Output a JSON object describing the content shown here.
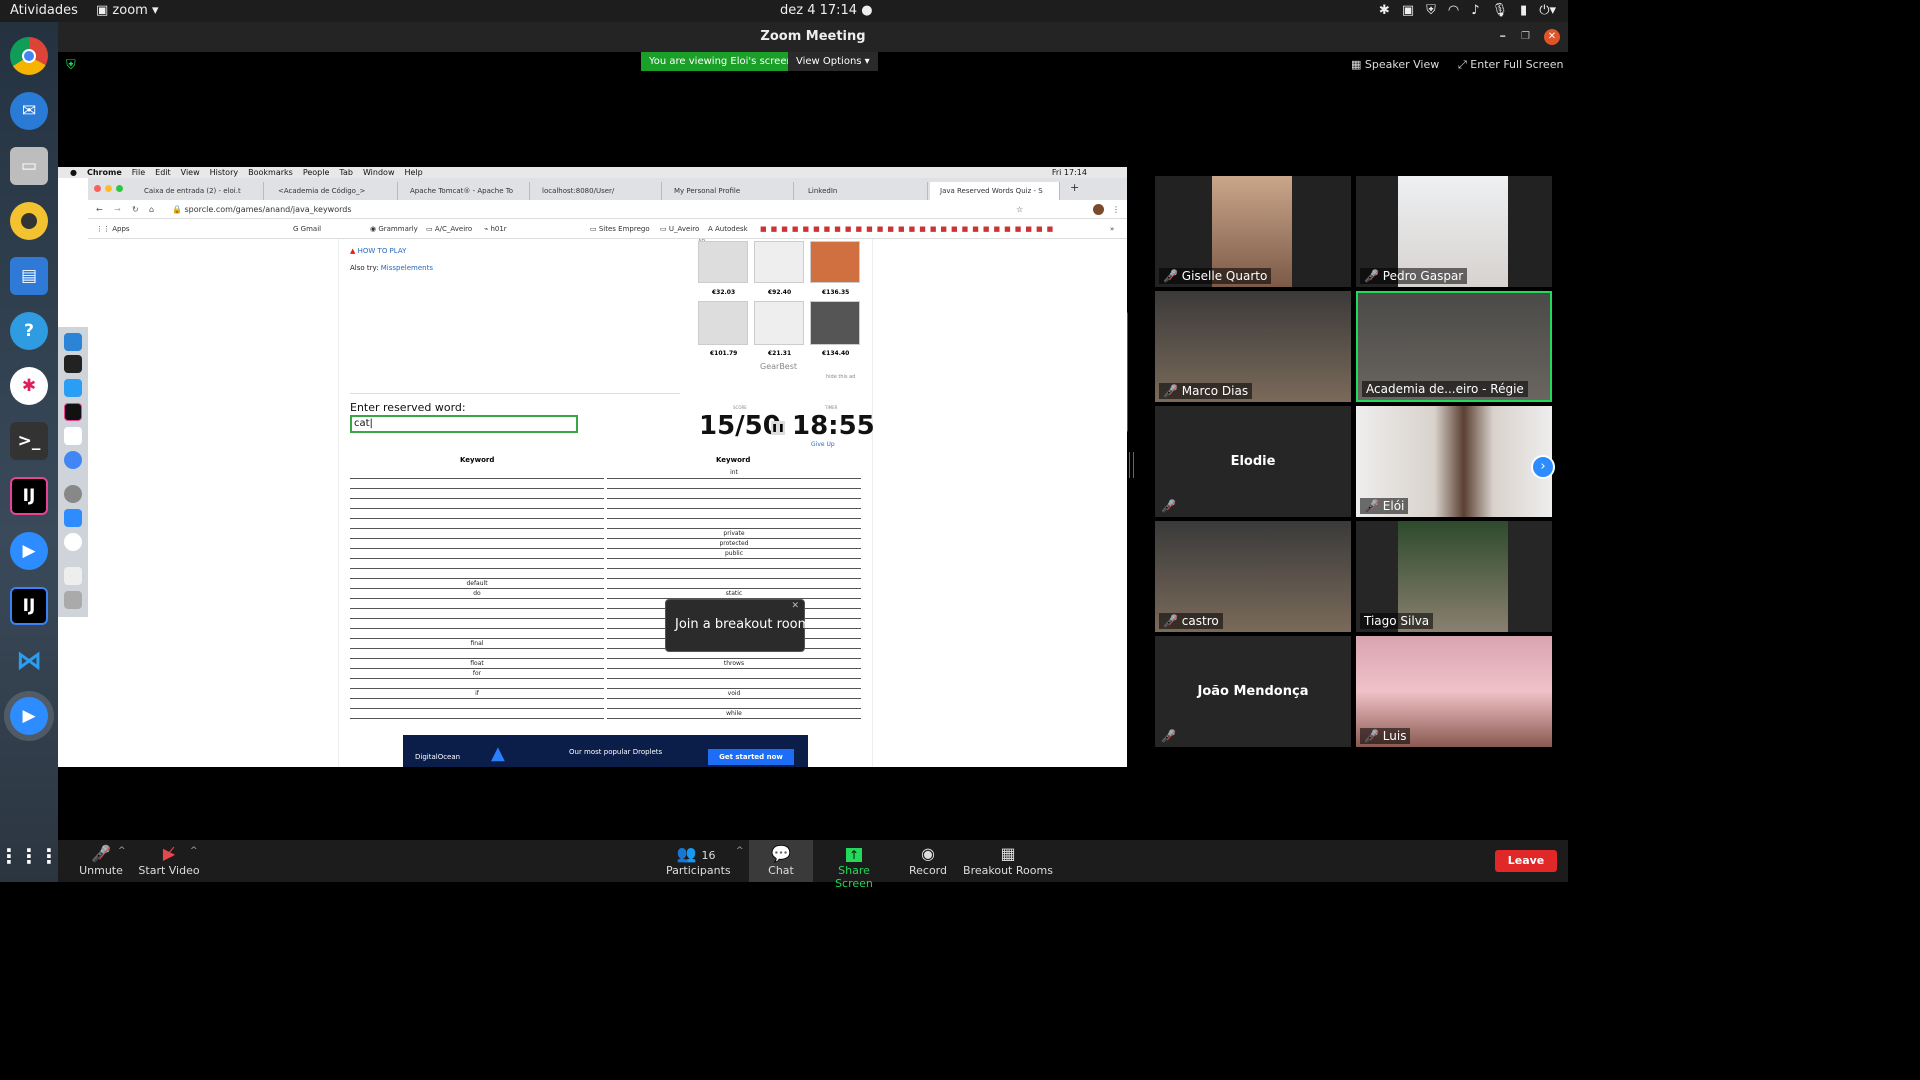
{
  "topbar": {
    "activities": "Atividades",
    "app": "zoom",
    "clock": "dez 4  17:14"
  },
  "window": {
    "title": "Zoom Meeting"
  },
  "share": {
    "banner": "You are viewing Eloi's screen",
    "view_options": "View Options"
  },
  "view": {
    "speaker": "Speaker View",
    "fullscreen": "Enter Full Screen"
  },
  "mac": {
    "menu": [
      "Chrome",
      "File",
      "Edit",
      "View",
      "History",
      "Bookmarks",
      "People",
      "Tab",
      "Window",
      "Help"
    ],
    "clock": "Fri 17:14"
  },
  "chrome": {
    "tabs": [
      "Caixa de entrada (2) - eloi.t",
      "<Academia de Código_>",
      "Apache Tomcat® - Apache To",
      "localhost:8080/User/",
      "My Personal Profile",
      "LinkedIn",
      "Java Reserved Words Quiz - S"
    ],
    "url": "sporcle.com/games/anand/java_keywords",
    "bookmarks": [
      "Apps",
      "Gmail",
      "Grammarly",
      "A/C_Aveiro",
      "h01r",
      "Sites Emprego",
      "U_Aveiro",
      "Autodesk"
    ]
  },
  "quiz": {
    "how_to_play": "HOW TO PLAY",
    "also_try": "Also try:",
    "also_try_link": "Misspelements",
    "ad": "AD",
    "gearbest": "GearBest",
    "hide_ad": "hide this ad",
    "prices": [
      "€32.03",
      "€92.40",
      "€136.35",
      "€101.79",
      "€21.31",
      "€134.40"
    ],
    "enter_label": "Enter reserved word:",
    "input_value": "cat",
    "score_label": "SCORE",
    "score": "15/50",
    "timer_label": "TIMER",
    "timer": "18:55",
    "give_up": "Give Up",
    "col_header": "Keyword",
    "col1": [
      "",
      "",
      "",
      "",
      "",
      "",
      "",
      "",
      "",
      "",
      "",
      "default",
      "do",
      "",
      "",
      "",
      "",
      "final",
      "",
      "float",
      "for",
      "",
      "if",
      "",
      ""
    ],
    "col2": [
      "int",
      "",
      "",
      "",
      "",
      "",
      "private",
      "protected",
      "public",
      "",
      "",
      "",
      "static",
      "",
      "",
      "",
      "",
      "",
      "",
      "throws",
      "",
      "",
      "void",
      "",
      "while"
    ],
    "ad2": {
      "brand": "DigitalOcean",
      "text": "Our most popular Droplets",
      "cta": "Get started now"
    }
  },
  "breakout": {
    "text": "Join a breakout room"
  },
  "participants": [
    {
      "name": "Giselle Quarto"
    },
    {
      "name": "Pedro Gaspar"
    },
    {
      "name": "Marco Dias"
    },
    {
      "name": "Academia de...eiro - Régie"
    },
    {
      "name": "Elodie"
    },
    {
      "name": "Elói"
    },
    {
      "name": "castro"
    },
    {
      "name": "Tiago Silva"
    },
    {
      "name": "João Mendonça"
    },
    {
      "name": "Luis"
    }
  ],
  "toolbar": {
    "unmute": "Unmute",
    "start_video": "Start Video",
    "participants": "Participants",
    "participant_count": "16",
    "chat": "Chat",
    "share": "Share Screen",
    "record": "Record",
    "breakout": "Breakout Rooms",
    "leave": "Leave"
  },
  "colors": {
    "zoom_green": "#23d959",
    "share_banner": "#1a9f29",
    "leave_red": "#e02828",
    "active_border": "#23d959"
  }
}
